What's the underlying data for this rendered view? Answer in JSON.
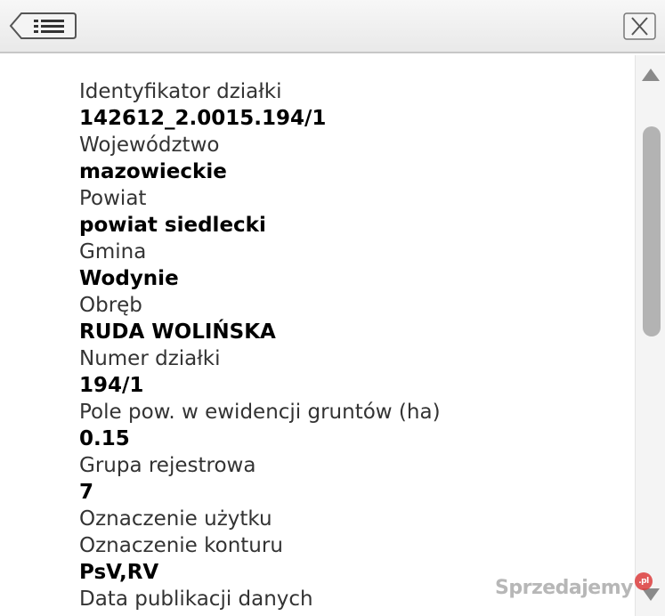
{
  "header": {
    "back_icon": "list-back-icon",
    "close_icon": "close-icon"
  },
  "fields": [
    {
      "label": "Identyfikator działki",
      "value": "142612_2.0015.194/1"
    },
    {
      "label": "Województwo",
      "value": "mazowieckie"
    },
    {
      "label": "Powiat",
      "value": "powiat siedlecki"
    },
    {
      "label": "Gmina",
      "value": "Wodynie"
    },
    {
      "label": "Obręb",
      "value": "RUDA WOLIŃSKA"
    },
    {
      "label": "Numer działki",
      "value": "194/1"
    },
    {
      "label": "Pole pow. w ewidencji gruntów (ha)",
      "value": "0.15"
    },
    {
      "label": "Grupa rejestrowa",
      "value": "7"
    },
    {
      "label": "Oznaczenie użytku",
      "value": ""
    },
    {
      "label": "Oznaczenie konturu",
      "value": "PsV,RV"
    },
    {
      "label": "Data publikacji danych",
      "value": ""
    }
  ],
  "watermark": {
    "text": "Sprzedajemy",
    "badge": ".pl"
  },
  "colors": {
    "header_bg": "#ececec",
    "scroll_thumb": "#b3b3b3",
    "label": "#333333",
    "value": "#000000"
  }
}
